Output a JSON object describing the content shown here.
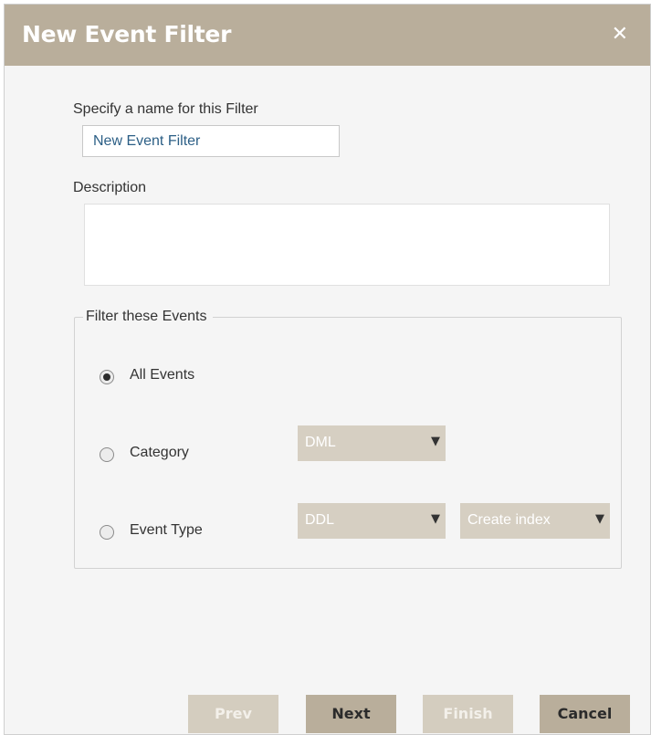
{
  "dialog": {
    "title": "New Event Filter",
    "close_icon": "close-icon"
  },
  "form": {
    "name_label": "Specify a name for this Filter",
    "name_value": "New Event Filter",
    "description_label": "Description",
    "description_value": ""
  },
  "filter_group": {
    "legend": "Filter these Events",
    "options": [
      {
        "label": "All Events",
        "selected": true
      },
      {
        "label": "Category",
        "selected": false
      },
      {
        "label": "Event Type",
        "selected": false
      }
    ],
    "category_select": {
      "value": "DML",
      "enabled": false
    },
    "event_type_select": {
      "value": "DDL",
      "enabled": false
    },
    "event_subtype_select": {
      "value": "Create index",
      "enabled": false
    }
  },
  "buttons": {
    "prev": {
      "label": "Prev",
      "enabled": false
    },
    "next": {
      "label": "Next",
      "enabled": true
    },
    "finish": {
      "label": "Finish",
      "enabled": false
    },
    "cancel": {
      "label": "Cancel",
      "enabled": true
    }
  },
  "colors": {
    "title_bar": "#b9ae9b",
    "button_enabled": "#b9ae9b",
    "button_disabled": "#d4cdbf",
    "select_disabled": "#d6cfc2",
    "input_text": "#2c5f86"
  }
}
